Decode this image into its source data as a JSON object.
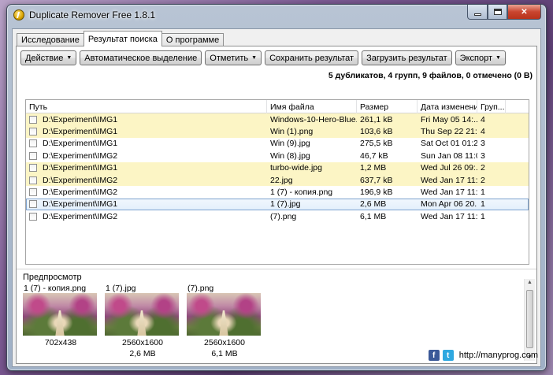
{
  "window": {
    "title": "Duplicate Remover Free 1.8.1"
  },
  "tabs": [
    {
      "label": "Исследование"
    },
    {
      "label": "Результат поиска"
    },
    {
      "label": "О программе"
    }
  ],
  "toolbar": {
    "action": "Действие",
    "auto_select": "Автоматическое выделение",
    "mark": "Отметить",
    "save_result": "Сохранить результат",
    "load_result": "Загрузить результат",
    "export": "Экспорт"
  },
  "summary": "5 дубликатов, 4 групп, 9 файлов, 0 отмечено (0 B)",
  "columns": {
    "path": "Путь",
    "name": "Имя файла",
    "size": "Размер",
    "date": "Дата изменения",
    "group": "Груп..."
  },
  "rows": [
    {
      "path": "D:\\Experiment\\IMG1",
      "name": "Windows-10-Hero-Blue...",
      "size": "261,1 kB",
      "date": "Fri May 05 14:...",
      "group": "4",
      "style": "hl"
    },
    {
      "path": "D:\\Experiment\\IMG1",
      "name": "Win (1).png",
      "size": "103,6 kB",
      "date": "Thu Sep 22 21:...",
      "group": "4",
      "style": "hl"
    },
    {
      "path": "D:\\Experiment\\IMG1",
      "name": "Win (9).jpg",
      "size": "275,5 kB",
      "date": "Sat Oct 01 01:2...",
      "group": "3",
      "style": ""
    },
    {
      "path": "D:\\Experiment\\IMG2",
      "name": "Win (8).jpg",
      "size": "46,7 kB",
      "date": "Sun Jan 08 11:0...",
      "group": "3",
      "style": ""
    },
    {
      "path": "D:\\Experiment\\IMG1",
      "name": "turbo-wide.jpg",
      "size": "1,2 MB",
      "date": "Wed Jul 26 09:...",
      "group": "2",
      "style": "hl"
    },
    {
      "path": "D:\\Experiment\\IMG2",
      "name": "22.jpg",
      "size": "637,7 kB",
      "date": "Wed Jan 17 11:...",
      "group": "2",
      "style": "hl"
    },
    {
      "path": "D:\\Experiment\\IMG2",
      "name": "1 (7) - копия.png",
      "size": "196,9 kB",
      "date": "Wed Jan 17 11:...",
      "group": "1",
      "style": ""
    },
    {
      "path": "D:\\Experiment\\IMG1",
      "name": "1 (7).jpg",
      "size": "2,6 MB",
      "date": "Mon Apr 06 20...",
      "group": "1",
      "style": "sel"
    },
    {
      "path": "D:\\Experiment\\IMG2",
      "name": "(7).png",
      "size": "6,1 MB",
      "date": "Wed Jan 17 11:...",
      "group": "1",
      "style": ""
    }
  ],
  "preview": {
    "label": "Предпросмотр",
    "items": [
      {
        "title": "1 (7) - копия.png",
        "line1": "702x438",
        "line2": ""
      },
      {
        "title": "1 (7).jpg",
        "line1": "2560x1600",
        "line2": "2,6 MB"
      },
      {
        "title": "(7).png",
        "line1": "2560x1600",
        "line2": "6,1 MB"
      }
    ]
  },
  "footer": {
    "link": "http://manyprog.com"
  }
}
